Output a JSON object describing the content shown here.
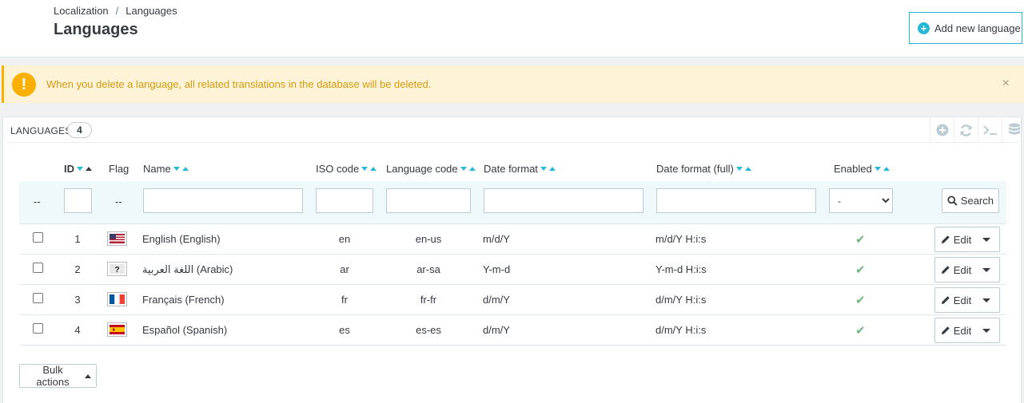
{
  "header": {
    "breadcrumb": [
      "Localization",
      "Languages"
    ],
    "separator": "/",
    "title": "Languages",
    "add_button_label": "Add new language"
  },
  "alert": {
    "text": "When you delete a language, all related translations in the database will be deleted.",
    "close": "×"
  },
  "panel": {
    "title": "LANGUAGES",
    "count": "4",
    "tools": [
      "add-icon",
      "refresh-icon",
      "sql-query-icon",
      "database-export-icon"
    ]
  },
  "columns": {
    "id": "ID",
    "flag": "Flag",
    "name": "Name",
    "iso_code": "ISO code",
    "language_code": "Language code",
    "date_format": "Date format",
    "date_format_full": "Date format (full)",
    "enabled": "Enabled"
  },
  "filters": {
    "placeholder_dash": "--",
    "enabled_selected": "-",
    "search_label": "Search"
  },
  "rows": [
    {
      "id": "1",
      "flag": "us",
      "name": "English (English)",
      "iso": "en",
      "code": "en-us",
      "date": "m/d/Y",
      "date_full": "m/d/Y H:i:s",
      "enabled": true
    },
    {
      "id": "2",
      "flag": "unknown",
      "name": "اللغة العربية (Arabic)",
      "iso": "ar",
      "code": "ar-sa",
      "date": "Y-m-d",
      "date_full": "Y-m-d H:i:s",
      "enabled": true
    },
    {
      "id": "3",
      "flag": "fr",
      "name": "Français (French)",
      "iso": "fr",
      "code": "fr-fr",
      "date": "d/m/Y",
      "date_full": "d/m/Y H:i:s",
      "enabled": true
    },
    {
      "id": "4",
      "flag": "es",
      "name": "Español (Spanish)",
      "iso": "es",
      "code": "es-es",
      "date": "d/m/Y",
      "date_full": "d/m/Y H:i:s",
      "enabled": true
    }
  ],
  "row_actions": {
    "edit_label": "Edit"
  },
  "bulk_actions_label": "Bulk actions",
  "colors": {
    "accent": "#25b9d7",
    "warning": "#fab000",
    "success": "#70b580"
  }
}
